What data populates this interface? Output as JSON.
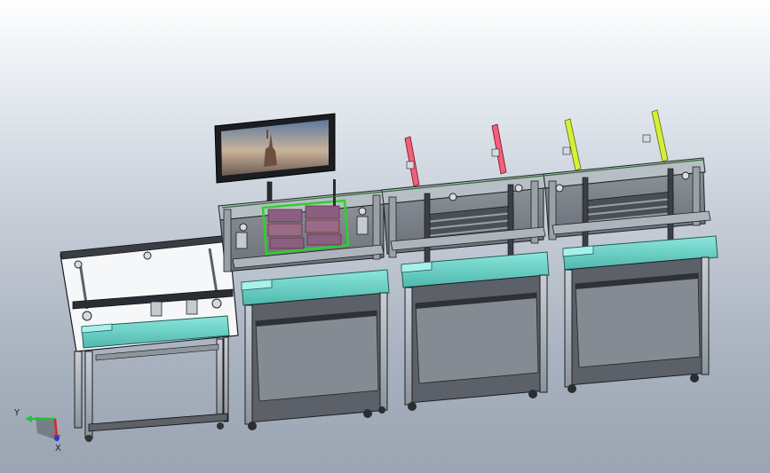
{
  "viewport": {
    "background_top": "#ffffff",
    "background_bottom": "#9aa4b2"
  },
  "triad": {
    "y_label": "Y",
    "x_label": "X",
    "y_color": "#22c03a",
    "x_color": "#e0231b",
    "z_color": "#1f3fd6"
  },
  "colors": {
    "frame_steel": "#9aa0a8",
    "frame_dark": "#2c3036",
    "cabinet_panel": "#7d838b",
    "conveyor_cyan": "#6fd3c8",
    "highlight_green": "#2dd12d",
    "sensor_red": "#f0607a",
    "sensor_yellow": "#d6f03a",
    "monitor_bezel": "#1b1d21"
  },
  "icons": {
    "triad": "coordinate-triad-icon"
  }
}
